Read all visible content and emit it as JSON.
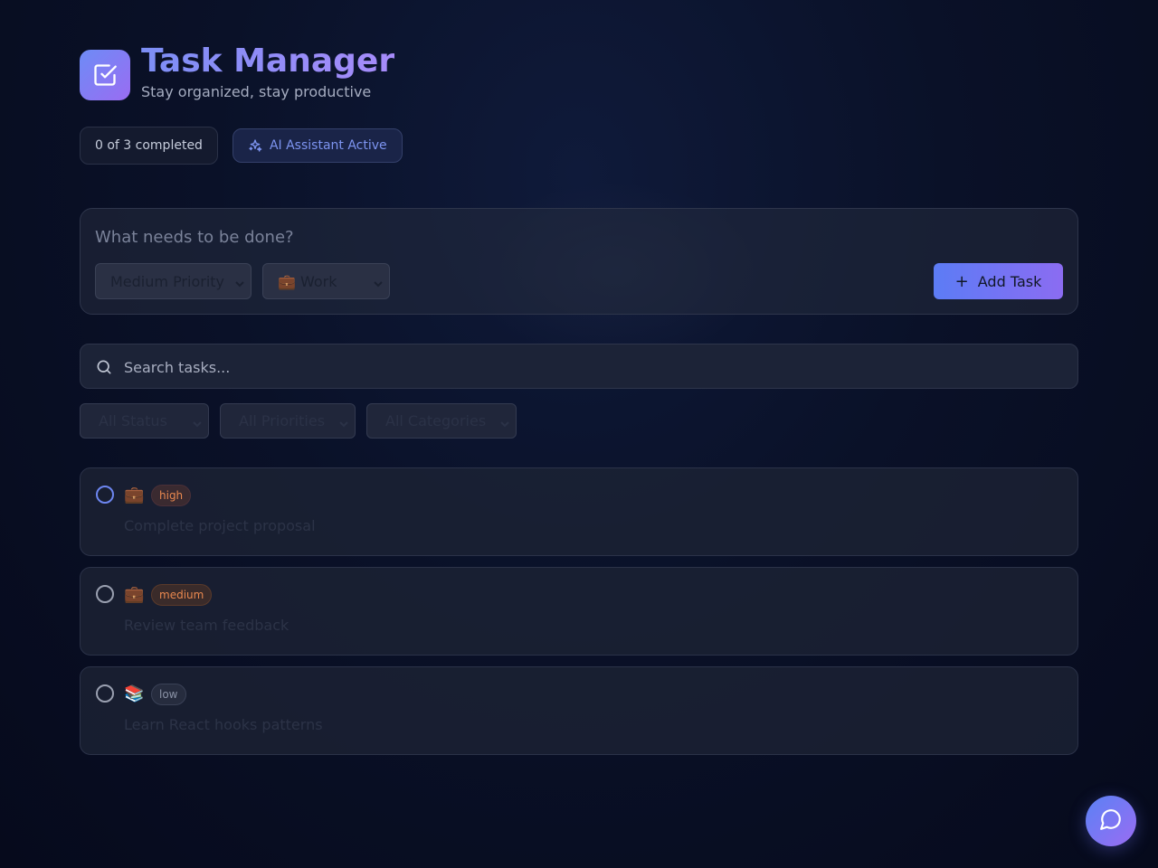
{
  "header": {
    "title": "Task Manager",
    "subtitle": "Stay organized, stay productive",
    "logo_icon": "check-square-icon"
  },
  "badges": {
    "progress": "0 of 3 completed",
    "ai": "AI Assistant Active"
  },
  "composer": {
    "placeholder": "What needs to be done?",
    "priority_selected": "Medium Priority",
    "category_selected": "💼 Work",
    "add_button": "Add Task"
  },
  "search": {
    "placeholder": "Search tasks..."
  },
  "filters": {
    "status": "All Status",
    "priority": "All Priorities",
    "category": "All Categories"
  },
  "tasks": [
    {
      "category_emoji": "💼",
      "priority": "high",
      "title": "Complete project proposal"
    },
    {
      "category_emoji": "💼",
      "priority": "medium",
      "title": "Review team feedback"
    },
    {
      "category_emoji": "📚",
      "priority": "low",
      "title": "Learn React hooks patterns"
    }
  ],
  "colors": {
    "accent_start": "#5c7cf5",
    "accent_end": "#8b6cf2",
    "priority_high": "#e9884f",
    "priority_medium": "#e9884f",
    "priority_low": "#8a92a6"
  },
  "chat_button_icon": "chat-bubble-icon"
}
